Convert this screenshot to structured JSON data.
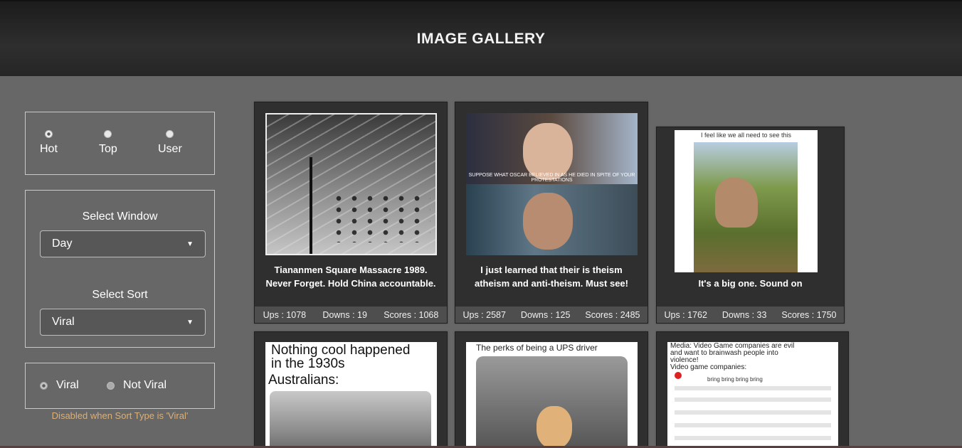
{
  "header": {
    "title": "IMAGE GALLERY"
  },
  "section_radios": {
    "options": [
      "Hot",
      "Top",
      "User"
    ],
    "selected": "Hot"
  },
  "window_select": {
    "label": "Select Window",
    "value": "Day"
  },
  "sort_select": {
    "label": "Select Sort",
    "value": "Viral"
  },
  "viral_radios": {
    "options": [
      "Viral",
      "Not Viral"
    ],
    "hint": "Disabled when Sort Type is 'Viral'"
  },
  "icons": {
    "dropdown": "dropdown-arrow-icon"
  },
  "cards": [
    {
      "title_line1": "Tiananmen Square Massacre 1989.",
      "title_line2": "Never Forget. Hold China accountable.",
      "ups": "Ups : 1078",
      "downs": "Downs : 19",
      "scores": "Scores : 1068"
    },
    {
      "title_line1": "I just learned that their is theism",
      "title_line2": "atheism and anti-theism. Must see!",
      "image_caption": "SUPPOSE WHAT OSCAR BELIEVED IN AS HE DIED IN SPITE OF YOUR PROTESTATIONS",
      "ups": "Ups : 2587",
      "downs": "Downs : 125",
      "scores": "Scores : 2485"
    },
    {
      "title_line1": "It's a big one. Sound on",
      "image_caption": "I feel like we all need to see this",
      "ups": "Ups : 1762",
      "downs": "Downs : 33",
      "scores": "Scores : 1750"
    },
    {
      "image_text_line1": "Nothing cool happened",
      "image_text_line2": "in the 1930s",
      "image_text_line3": "Australians:"
    },
    {
      "image_text": "The perks of being a UPS driver"
    },
    {
      "image_text_line1": "Media: Video Game companies are evil",
      "image_text_line2": "and want to brainwash people into",
      "image_text_line3": "violence!",
      "image_text_line4": "Video game companies:",
      "tweet_text": "bring bring bring bring"
    }
  ]
}
